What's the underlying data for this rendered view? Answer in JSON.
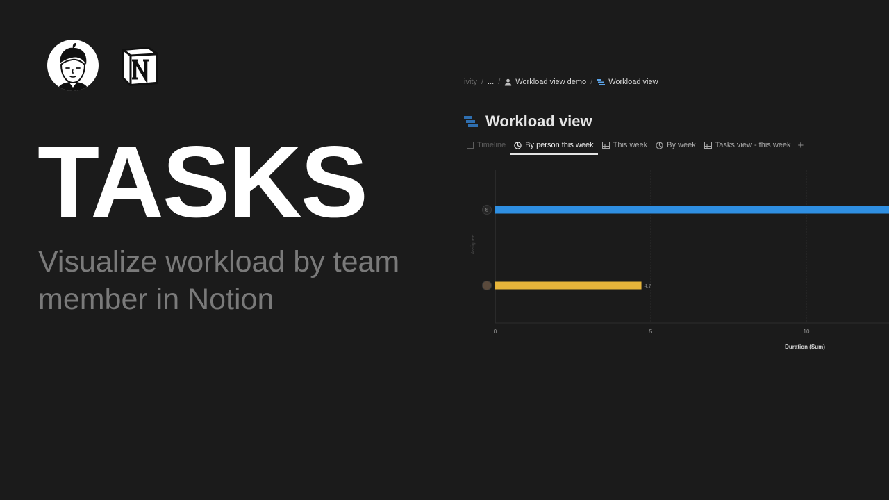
{
  "hero": {
    "title": "TASKS",
    "subtitle_line1": "Visualize workload by team",
    "subtitle_line2": "member in Notion"
  },
  "icons": {
    "brand_avatar": "cartoon-face-logo",
    "brand_notion": "notion-logo"
  },
  "breadcrumb": {
    "items": [
      "ivity",
      "...",
      "Workload view demo",
      "Workload view"
    ],
    "separator": "/"
  },
  "page": {
    "title": "Workload view"
  },
  "tabs": [
    {
      "label": "Timeline",
      "icon": "timeline-icon"
    },
    {
      "label": "By person this week",
      "icon": "chart-icon",
      "active": true
    },
    {
      "label": "This week",
      "icon": "table-icon"
    },
    {
      "label": "By week",
      "icon": "chart-icon"
    },
    {
      "label": "Tasks view - this week",
      "icon": "table-icon"
    }
  ],
  "add_tab_label": "+",
  "chart_data": {
    "type": "bar",
    "orientation": "horizontal",
    "ylabel": "Assignee",
    "xlabel": "Duration (Sum)",
    "x_ticks": [
      "0",
      "5",
      "10"
    ],
    "xlim": [
      0,
      12.7
    ],
    "categories": [
      "S",
      "avatar"
    ],
    "values": [
      12.7,
      4.7
    ],
    "data_labels": [
      "",
      "4.7"
    ],
    "colors": [
      "#2f8fe2",
      "#e6b43a"
    ],
    "grid": true
  },
  "colors": {
    "background": "#1b1b1b",
    "hero_title": "#ffffff",
    "hero_subtitle": "#7a7a7a",
    "bar_blue": "#2f8fe2",
    "bar_yellow": "#e6b43a"
  }
}
